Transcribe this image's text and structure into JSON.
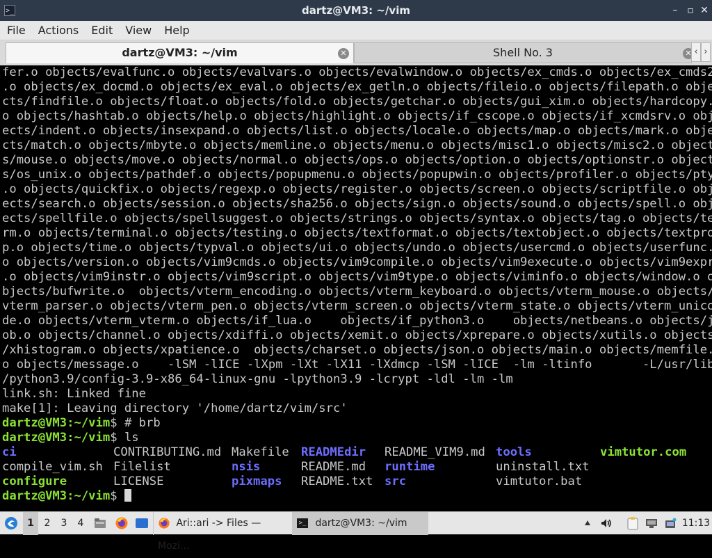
{
  "window": {
    "title": "dartz@VM3: ~/vim",
    "app_icon": ">_",
    "minimize": "–",
    "maximize": "▫",
    "close": "✕"
  },
  "menu": [
    "File",
    "Actions",
    "Edit",
    "View",
    "Help"
  ],
  "tabs": [
    {
      "label": "dartz@VM3: ~/vim",
      "active": true
    },
    {
      "label": "Shell No. 3",
      "active": false
    }
  ],
  "tab_scroll": {
    "left": "‹",
    "right": "›"
  },
  "terminal": {
    "output_lines": [
      "fer.o objects/evalfunc.o objects/evalvars.o objects/evalwindow.o objects/ex_cmds.o objects/ex_cmds2",
      ".o objects/ex_docmd.o objects/ex_eval.o objects/ex_getln.o objects/fileio.o objects/filepath.o obje",
      "cts/findfile.o objects/float.o objects/fold.o objects/getchar.o objects/gui_xim.o objects/hardcopy.",
      "o objects/hashtab.o objects/help.o objects/highlight.o objects/if_cscope.o objects/if_xcmdsrv.o obj",
      "ects/indent.o objects/insexpand.o objects/list.o objects/locale.o objects/map.o objects/mark.o obje",
      "cts/match.o objects/mbyte.o objects/memline.o objects/menu.o objects/misc1.o objects/misc2.o object",
      "s/mouse.o objects/move.o objects/normal.o objects/ops.o objects/option.o objects/optionstr.o object",
      "s/os_unix.o objects/pathdef.o objects/popupmenu.o objects/popupwin.o objects/profiler.o objects/pty",
      ".o objects/quickfix.o objects/regexp.o objects/register.o objects/screen.o objects/scriptfile.o obj",
      "ects/search.o objects/session.o objects/sha256.o objects/sign.o objects/sound.o objects/spell.o obj",
      "ects/spellfile.o objects/spellsuggest.o objects/strings.o objects/syntax.o objects/tag.o objects/te",
      "rm.o objects/terminal.o objects/testing.o objects/textformat.o objects/textobject.o objects/textpro",
      "p.o objects/time.o objects/typval.o objects/ui.o objects/undo.o objects/usercmd.o objects/userfunc.",
      "o objects/version.o objects/vim9cmds.o objects/vim9compile.o objects/vim9execute.o objects/vim9expr",
      ".o objects/vim9instr.o objects/vim9script.o objects/vim9type.o objects/viminfo.o objects/window.o o",
      "bjects/bufwrite.o  objects/vterm_encoding.o objects/vterm_keyboard.o objects/vterm_mouse.o objects/",
      "vterm_parser.o objects/vterm_pen.o objects/vterm_screen.o objects/vterm_state.o objects/vterm_unico",
      "de.o objects/vterm_vterm.o objects/if_lua.o    objects/if_python3.o    objects/netbeans.o objects/j",
      "ob.o objects/channel.o objects/xdiffi.o objects/xemit.o objects/xprepare.o objects/xutils.o objects",
      "/xhistogram.o objects/xpatience.o  objects/charset.o objects/json.o objects/main.o objects/memfile.",
      "o objects/message.o    -lSM -lICE -lXpm -lXt -lX11 -lXdmcp -lSM -lICE  -lm -ltinfo       -L/usr/lib",
      "/python3.9/config-3.9-x86_64-linux-gnu -lpython3.9 -lcrypt -ldl -lm -lm",
      "link.sh: Linked fine",
      "make[1]: Leaving directory '/home/dartz/vim/src'"
    ],
    "prompt_user": "dartz@VM3",
    "prompt_path": ":~/vim",
    "prompt_symbol": "$ ",
    "commands": [
      "# brb",
      "ls"
    ],
    "ls_rows": [
      [
        {
          "name": "ci",
          "type": "dir"
        },
        {
          "name": "CONTRIBUTING.md",
          "type": "file"
        },
        {
          "name": "Makefile",
          "type": "file"
        },
        {
          "name": "READMEdir",
          "type": "dir"
        },
        {
          "name": "README_VIM9.md",
          "type": "file"
        },
        {
          "name": "tools",
          "type": "dir"
        },
        {
          "name": "vimtutor.com",
          "type": "exec"
        }
      ],
      [
        {
          "name": "compile_vim.sh",
          "type": "file"
        },
        {
          "name": "Filelist",
          "type": "file"
        },
        {
          "name": "nsis",
          "type": "dir"
        },
        {
          "name": "README.md",
          "type": "file"
        },
        {
          "name": "runtime",
          "type": "dir"
        },
        {
          "name": "uninstall.txt",
          "type": "file"
        },
        {
          "name": "",
          "type": "file"
        }
      ],
      [
        {
          "name": "configure",
          "type": "exec"
        },
        {
          "name": "LICENSE",
          "type": "file"
        },
        {
          "name": "pixmaps",
          "type": "dir"
        },
        {
          "name": "README.txt",
          "type": "file"
        },
        {
          "name": "src",
          "type": "dir"
        },
        {
          "name": "vimtutor.bat",
          "type": "file"
        },
        {
          "name": "",
          "type": "file"
        }
      ]
    ]
  },
  "taskbar": {
    "workspaces": [
      "1",
      "2",
      "3",
      "4"
    ],
    "active_workspace": "1",
    "tasks": [
      {
        "label": "Ari::ari -> Files — Mozi...",
        "icon": "firefox-icon",
        "active": false
      },
      {
        "label": "dartz@VM3: ~/vim",
        "icon": "terminal-icon",
        "active": true
      }
    ],
    "clock": "11:13"
  },
  "colors": {
    "prompt_green": "#8ae234",
    "dir_blue": "#6d6dff",
    "terminal_bg": "#000000",
    "titlebar": "#2e3a4a"
  }
}
